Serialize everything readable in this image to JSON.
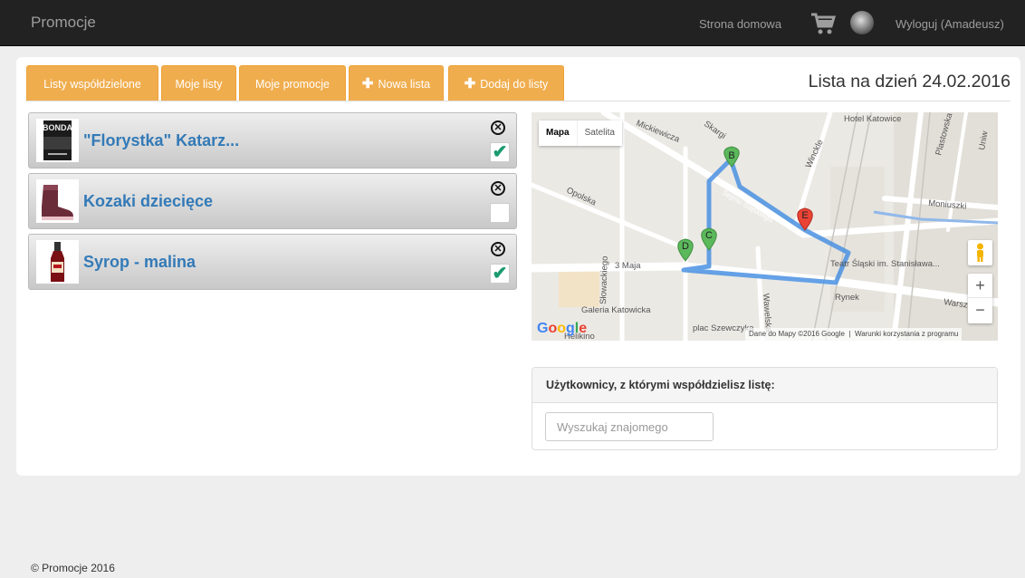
{
  "navbar": {
    "brand": "Promocje",
    "home_link": "Strona domowa",
    "logout_link": "Wyloguj (Amadeusz)"
  },
  "tabs": [
    {
      "label": "Listy współdzielone",
      "icon": ""
    },
    {
      "label": "Moje listy",
      "icon": ""
    },
    {
      "label": "Moje promocje",
      "icon": ""
    },
    {
      "label": "Nowa lista",
      "icon": "plus-icon"
    },
    {
      "label": "Dodaj do listy",
      "icon": "plus-icon"
    }
  ],
  "list_title": "Lista na dzień 24.02.2016",
  "items": [
    {
      "name": "\"Florystka\" Katarz...",
      "checked": true
    },
    {
      "name": "Kozaki dziecięce",
      "checked": false
    },
    {
      "name": "Syrop - malina",
      "checked": true
    }
  ],
  "map": {
    "type_buttons": [
      "Mapa",
      "Satelita"
    ],
    "streets": [
      "Mickiewicza",
      "Skargi",
      "Winckle",
      "Plastowska",
      "Moniuszki",
      "Opolska",
      "Słowackiego",
      "3 Maja",
      "Wawelska",
      "Warsz",
      "Sejmu Śląskiego",
      "Hotel Katowice",
      "Teatr Śląski im. Stanisława...",
      "Rynek",
      "Galeria Katowicka",
      "Helikino",
      "plac Szewczyka",
      "Uniw"
    ],
    "markers": [
      "B",
      "C",
      "D",
      "E"
    ],
    "zoom_in": "+",
    "zoom_out": "−",
    "logo": "Google",
    "attribution": "Dane do Mapy ©2016 Google",
    "terms": "Warunki korzystania z programu"
  },
  "users_panel": {
    "heading": "Użytkownicy, z którymi współdzielisz listę:",
    "search_placeholder": "Wyszukaj znajomego"
  },
  "footer": "© Promocje 2016"
}
